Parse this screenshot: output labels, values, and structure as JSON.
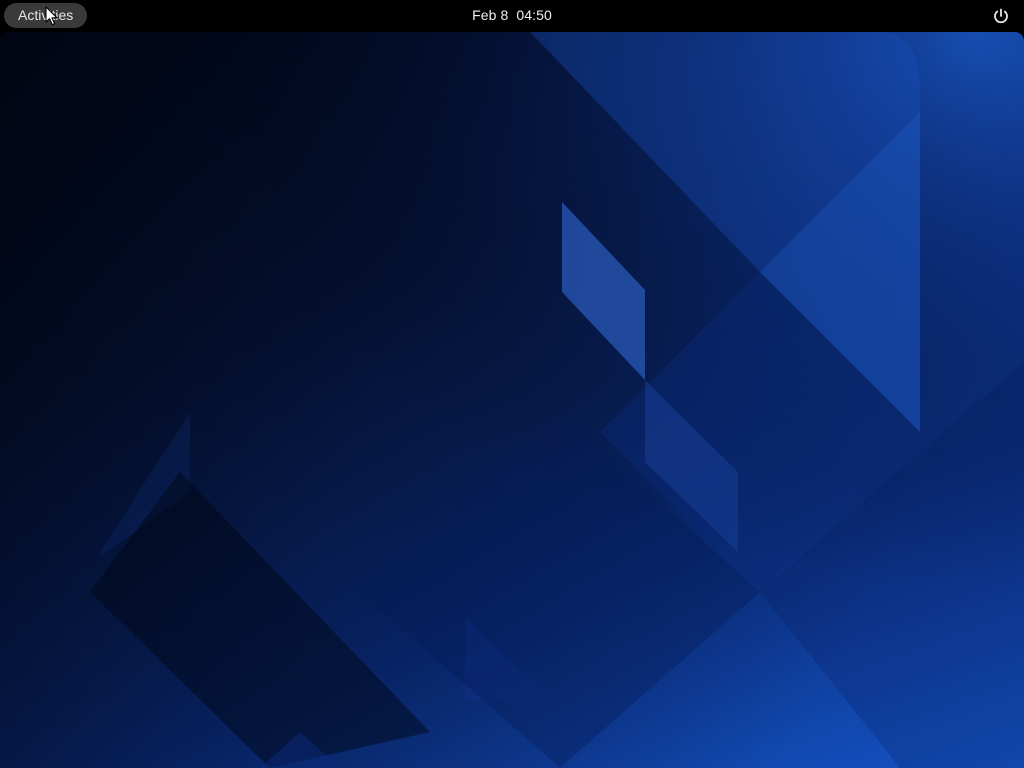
{
  "top_bar": {
    "activities_label": "Activities",
    "clock": "Feb 8  04:50",
    "power_icon": "power-icon"
  },
  "desktop": {
    "wallpaper": "blue-geometric-wallpaper"
  },
  "colors": {
    "top_bar_bg": "#000000",
    "activities_bg": "#3a3a3a",
    "text": "#f0f0f0",
    "wallpaper_dark": "#03081c",
    "wallpaper_light": "#1555c8"
  }
}
